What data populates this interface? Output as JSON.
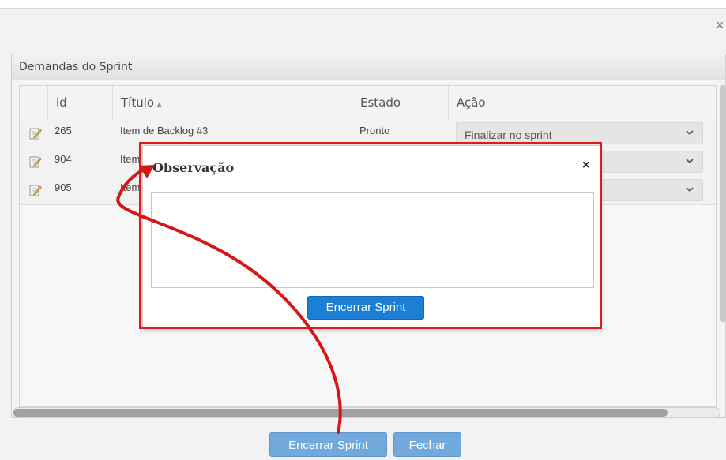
{
  "window": {
    "close_icon": "×"
  },
  "panel": {
    "title": "Demandas do Sprint"
  },
  "table": {
    "columns": [
      "id",
      "Título",
      "Estado",
      "Ação"
    ],
    "sort_indicator": "▲",
    "rows": [
      {
        "id": "265",
        "titulo": "Item de Backlog #3",
        "estado": "Pronto",
        "acao": "Finalizar no sprint"
      },
      {
        "id": "904",
        "titulo": "Item",
        "estado": "",
        "acao": ""
      },
      {
        "id": "905",
        "titulo": "Item",
        "estado": "",
        "acao": ""
      }
    ]
  },
  "modal": {
    "title": "Observação",
    "close_icon": "×",
    "textarea_value": "",
    "button_label": "Encerrar Sprint"
  },
  "footer": {
    "encerrar_label": "Encerrar Sprint",
    "fechar_label": "Fechar"
  },
  "colors": {
    "annotation_red": "#e01a1a",
    "primary_blue": "#1b7fd6",
    "disabled_blue": "#72a9dc"
  },
  "icons": [
    "edit-icon",
    "chevron-down-icon",
    "close-icon",
    "sort-asc-icon"
  ]
}
